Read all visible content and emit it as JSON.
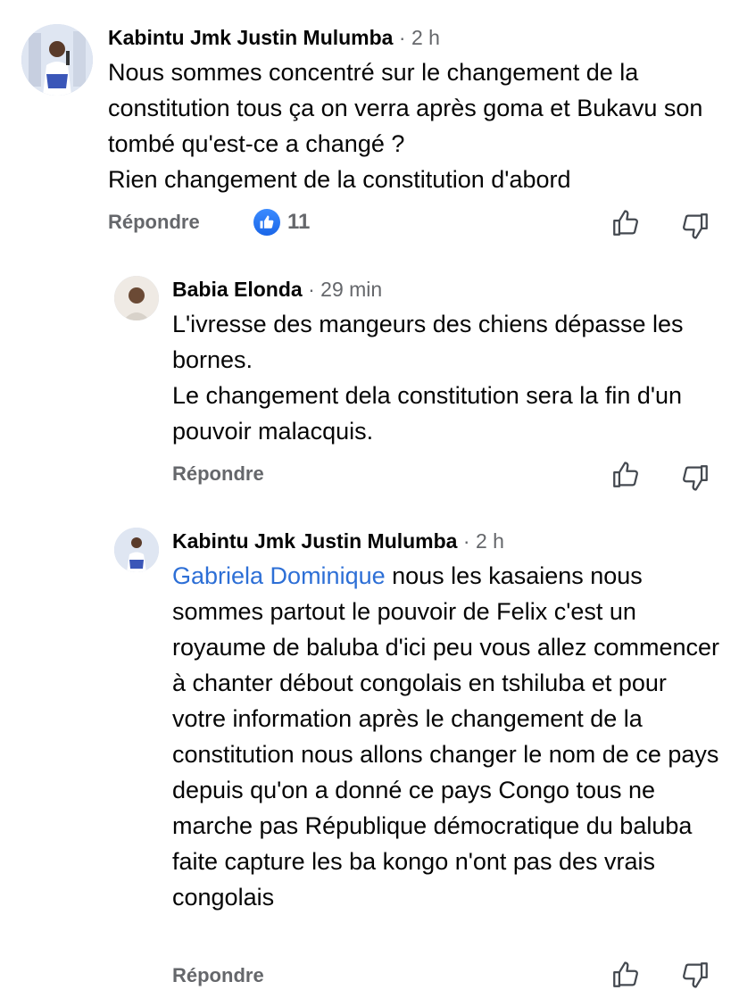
{
  "comments": [
    {
      "author": "Kabintu Jmk Justin Mulumba",
      "separator": "·",
      "time": "2 h",
      "text": "Nous sommes concentré sur le changement de la constitution tous ça on verra après goma et Bukavu son tombé qu'est-ce a changé ?\nRien changement de la constitution d'abord",
      "reply_label": "Répondre",
      "reaction_icon": "like-icon",
      "reaction_count": "11",
      "like_icon": "thumbs-up-icon",
      "dislike_icon": "thumbs-down-icon"
    },
    {
      "author": "Babia Elonda",
      "separator": "·",
      "time": "29 min",
      "text": "L'ivresse des mangeurs des chiens dépasse les bornes.\nLe changement dela constitution sera la fin d'un pouvoir malacquis.",
      "reply_label": "Répondre",
      "like_icon": "thumbs-up-icon",
      "dislike_icon": "thumbs-down-icon"
    },
    {
      "author": "Kabintu Jmk Justin Mulumba",
      "separator": "·",
      "time": "2 h",
      "mention": "Gabriela Dominique",
      "text": " nous les kasaiens nous sommes partout le pouvoir de Felix c'est un royaume de baluba d'ici peu vous allez commencer à chanter débout congolais en tshiluba et pour votre information après le changement de la constitution nous allons changer le nom de ce pays depuis qu'on a donné ce pays Congo tous ne marche pas République démocratique du baluba faite capture les ba kongo n'ont pas des vrais congolais",
      "reply_label": "Répondre",
      "like_icon": "thumbs-up-icon",
      "dislike_icon": "thumbs-down-icon"
    }
  ],
  "colors": {
    "text": "#050505",
    "muted": "#65676b",
    "mention": "#2d6fd6",
    "like_badge": "#1a66e8"
  }
}
